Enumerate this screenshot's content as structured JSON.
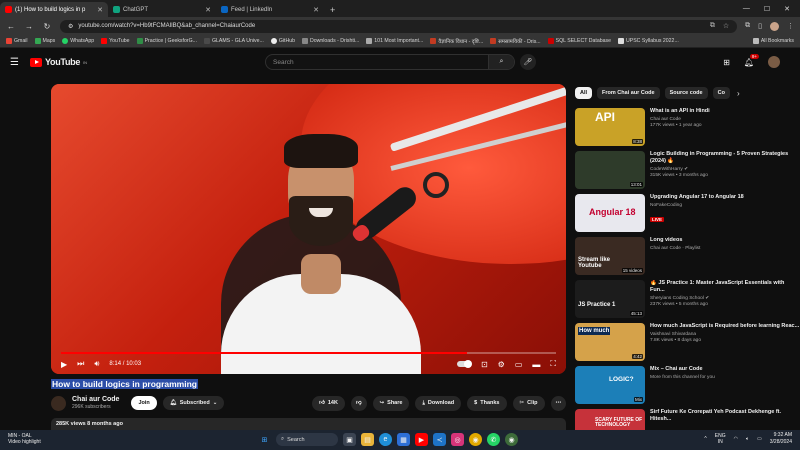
{
  "browser": {
    "tabs": [
      {
        "title": "(1) How to build logics in p",
        "color": "#ff0000",
        "active": true
      },
      {
        "title": "ChatGPT",
        "color": "#10a37f",
        "active": false
      },
      {
        "title": "Feed | LinkedIn",
        "color": "#0a66c2",
        "active": false
      }
    ],
    "url": "youtube.com/watch?v=Hb9tFCMAIlBQ&ab_channel=ChaiaurCode",
    "bookmarks": [
      {
        "label": "Gmail",
        "color": "#ea4335"
      },
      {
        "label": "Maps",
        "color": "#34a853"
      },
      {
        "label": "WhatsApp",
        "color": "#25d366"
      },
      {
        "label": "YouTube",
        "color": "#ff0000"
      },
      {
        "label": "Practice | GeeksforG...",
        "color": "#2f8d46"
      },
      {
        "label": "GLAMS - GLA Unive...",
        "color": "#4a4a4a"
      },
      {
        "label": "GitHub",
        "color": "#eeeeee"
      },
      {
        "label": "Downloads - Drishti...",
        "color": "#888888"
      },
      {
        "label": "101 Most Important...",
        "color": "#aaaaaa"
      },
      {
        "label": "वैज्ञानिक विधान - दृष्टि...",
        "color": "#c23b22"
      },
      {
        "label": "समसामयिकी - Dris...",
        "color": "#c23b22"
      },
      {
        "label": "SQL SELECT Database",
        "color": "#cc0000"
      },
      {
        "label": "UPSC Syllabus 2022...",
        "color": "#dddddd"
      }
    ],
    "all_bookmarks": "All Bookmarks"
  },
  "youtube": {
    "logo_text": "YouTube",
    "logo_region": "IN",
    "search_placeholder": "Search",
    "notifications": "9+"
  },
  "video": {
    "title": "How to build logics in programming",
    "time": "8:14 / 10:03",
    "progress": 0.82,
    "channel": "Chai aur Code",
    "subscribers": "296K subscribers",
    "join_label": "Join",
    "subscribed_label": "Subscribed",
    "likes": "14K",
    "share_label": "Share",
    "download_label": "Download",
    "thanks_label": "Thanks",
    "clip_label": "Clip",
    "views_line": "285K views  8 months ago"
  },
  "sidebar": {
    "chips": [
      {
        "label": "All",
        "active": true
      },
      {
        "label": "From Chai aur Code",
        "active": false
      },
      {
        "label": "Source code",
        "active": false
      },
      {
        "label": "Co",
        "active": false
      }
    ],
    "recommendations": [
      {
        "title": "What is an API in Hindi",
        "channel": "Chai aur Code",
        "meta": "177K views • 1 year ago",
        "duration": "8:38",
        "thumb_label": "API",
        "bg": "#c9a227"
      },
      {
        "title": "Logic Building in Programming - 5 Proven Strategies (2024) 🔥",
        "channel": "CodeWithHarry ✔",
        "meta": "315K views • 3 months ago",
        "duration": "13:01",
        "thumb_label": "",
        "bg": "#2e3b2a"
      },
      {
        "title": "Upgrading Angular 17 to Angular 18",
        "channel": "NoFakeCoding",
        "meta": "",
        "duration": "",
        "thumb_label": "Angular 18",
        "bg": "#e8e8ee",
        "live": "LIVE"
      },
      {
        "title": "Long videos",
        "channel": "Chai aur Code · Playlist",
        "meta": "",
        "duration": "15 videos",
        "thumb_label": "Stream like Youtube",
        "bg": "#3a2a22"
      },
      {
        "title": "🔥 JS Practice 1: Master JavaScript Essentials with Fun...",
        "channel": "Sheryians Coding School ✔",
        "meta": "237K views • 5 months ago",
        "duration": "45:13",
        "thumb_label": "JS Practice 1",
        "bg": "#1c1c1c"
      },
      {
        "title": "How much JavaScript is Required before learning Reac...",
        "channel": "Vaishnavi Shivardana",
        "meta": "7.8K views • 8 days ago",
        "duration": "4:42",
        "thumb_label": "How much",
        "bg": "#d5a24a"
      },
      {
        "title": "Mix – Chai aur Code",
        "channel": "More from this channel for you",
        "meta": "",
        "duration": "Mix",
        "thumb_label": "LOGIC?",
        "bg": "#1c7fb8"
      },
      {
        "title": "Sirf Future Ke Crorepati Yeh Podcast Dekhenge ft. Hitesh...",
        "channel": "",
        "meta": "",
        "duration": "",
        "thumb_label": "SCARY FUTURE OF TECHNOLOGY",
        "bg": "#c6323a"
      }
    ]
  },
  "taskbar": {
    "weather_temp": "MIN - OAL",
    "weather_text": "Video highlight",
    "search_placeholder": "Search",
    "lang_top": "ENG",
    "lang_bottom": "IN",
    "time": "9:32 AM",
    "date": "3/28/2024"
  }
}
